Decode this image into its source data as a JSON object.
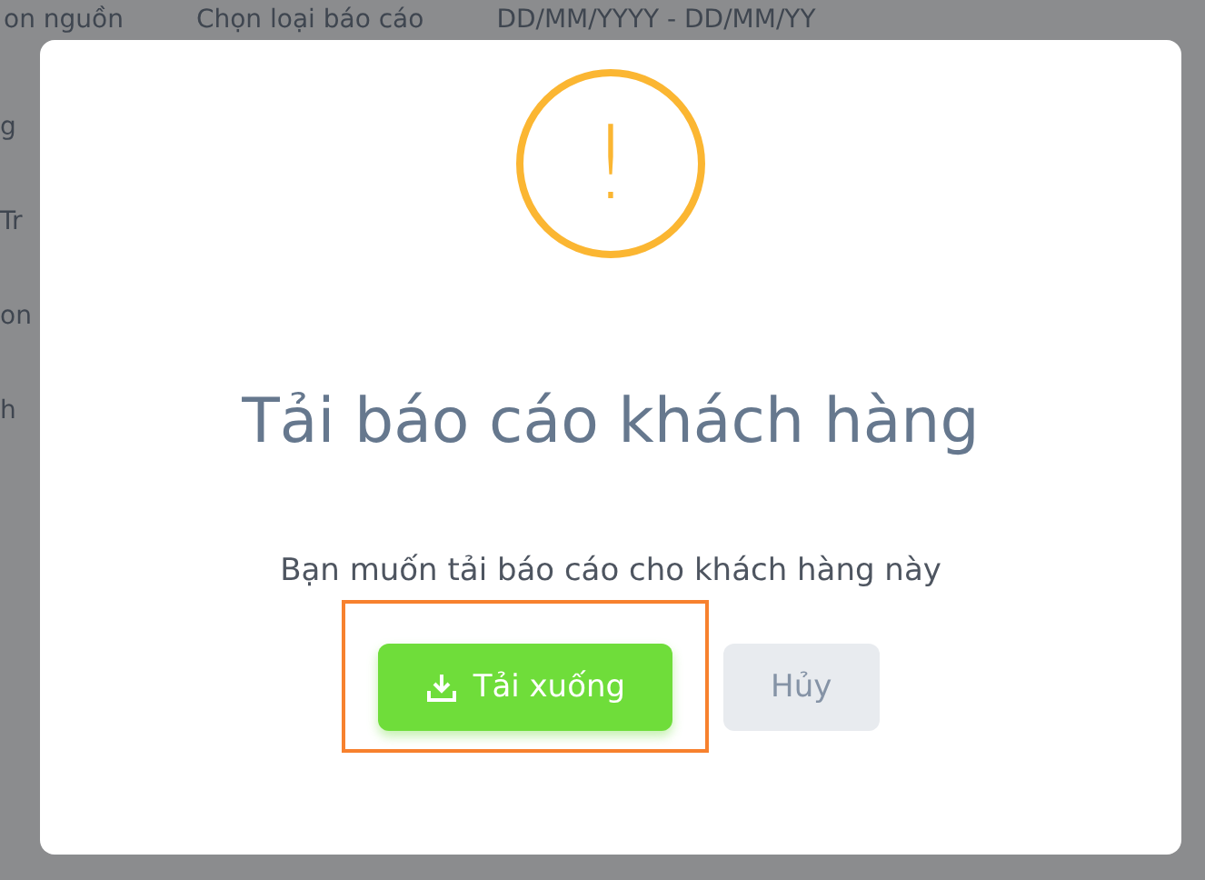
{
  "background": {
    "filters": [
      "on nguồn",
      "Chọn loại báo cáo",
      "DD/MM/YYYY - DD/MM/YY"
    ],
    "rows": [
      "g",
      "Tr",
      "on",
      "h"
    ]
  },
  "dialog": {
    "icon": "!",
    "title": "Tải báo cáo khách hàng",
    "message": "Bạn muốn tải báo cáo cho khách hàng này",
    "buttons": [
      {
        "kind": "primary",
        "label": "Tải xuống",
        "highlighted": true
      },
      {
        "kind": "secondary",
        "label": "Hủy",
        "highlighted": false
      }
    ]
  }
}
